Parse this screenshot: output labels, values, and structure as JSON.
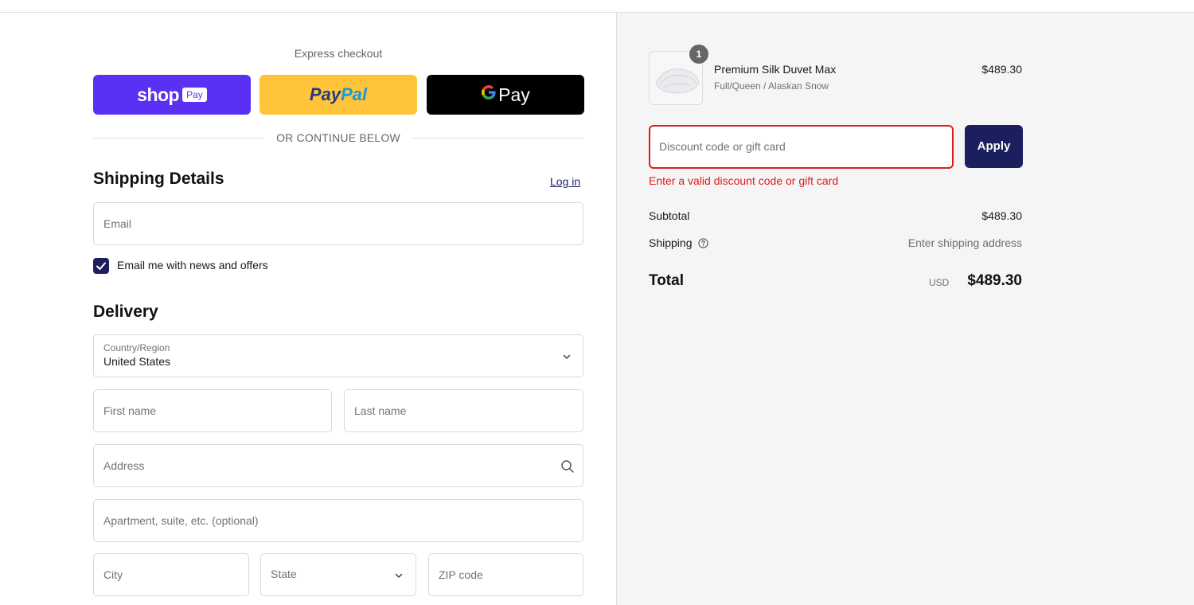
{
  "express": {
    "label": "Express checkout",
    "shop_pay": {
      "word": "shop",
      "pay": "Pay"
    },
    "paypal": {
      "part1": "Pay",
      "part2": "Pal"
    },
    "gpay": {
      "g": "G",
      "pay": "Pay"
    }
  },
  "divider_text": "OR CONTINUE BELOW",
  "shipping": {
    "title": "Shipping Details",
    "login": "Log in",
    "email_placeholder": "Email",
    "newsletter_label": "Email me with news and offers",
    "newsletter_checked": true
  },
  "delivery": {
    "title": "Delivery",
    "country_label": "Country/Region",
    "country_value": "United States",
    "first_name_placeholder": "First name",
    "last_name_placeholder": "Last name",
    "address_placeholder": "Address",
    "apartment_placeholder": "Apartment, suite, etc. (optional)",
    "city_placeholder": "City",
    "state_placeholder": "State",
    "zip_placeholder": "ZIP code"
  },
  "order": {
    "item": {
      "quantity": "1",
      "name": "Premium Silk Duvet Max",
      "variant": "Full/Queen / Alaskan Snow",
      "price": "$489.30"
    },
    "discount_placeholder": "Discount code or gift card",
    "apply_label": "Apply",
    "error": "Enter a valid discount code or gift card",
    "subtotal_label": "Subtotal",
    "subtotal_value": "$489.30",
    "shipping_label": "Shipping",
    "shipping_value": "Enter shipping address",
    "total_label": "Total",
    "currency": "USD",
    "total_value": "$489.30"
  },
  "colors": {
    "shop_pay": "#5a31f4",
    "paypal": "#ffc439",
    "gpay": "#000000",
    "primary": "#1b1f5e",
    "error": "#dd1d1d"
  }
}
